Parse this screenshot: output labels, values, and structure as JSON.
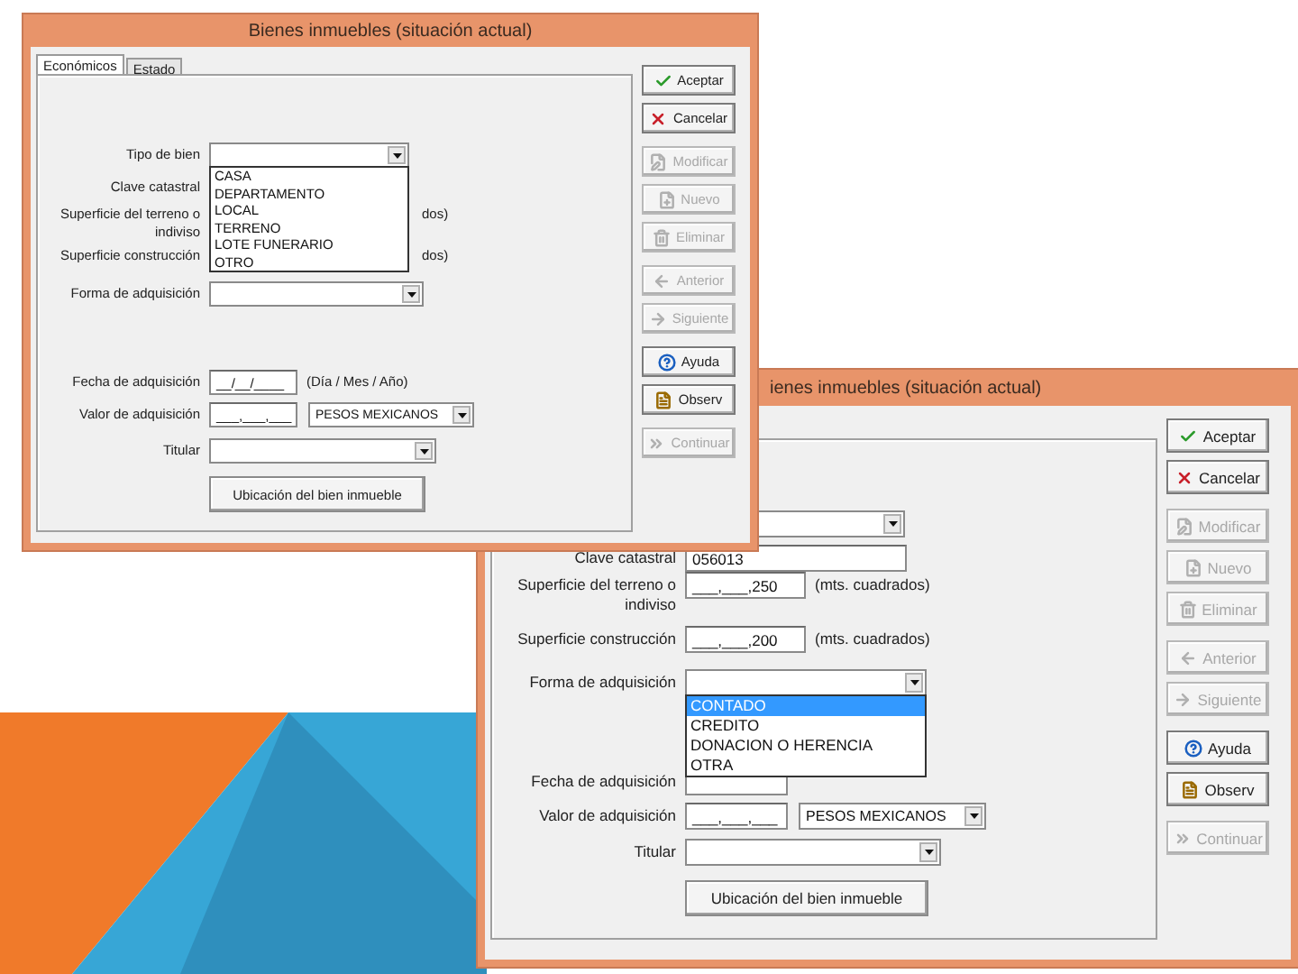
{
  "windows": [
    {
      "title": "Bienes inmuebles (situación actual)",
      "tabs": [
        {
          "label": "Económicos",
          "selected": true
        },
        {
          "label": "Estado",
          "selected": false
        }
      ],
      "rows": [
        {
          "kind": "field",
          "label": "Tipo de bien",
          "fields": [
            {
              "kind": "combo",
              "options": [
                {
                  "label": "CASA",
                  "selected": false
                },
                {
                  "label": "DEPARTAMENTO",
                  "selected": false
                },
                {
                  "label": "LOCAL",
                  "selected": false
                },
                {
                  "label": "TERRENO",
                  "selected": false
                },
                {
                  "label": "LOTE FUNERARIO",
                  "selected": false
                },
                {
                  "label": "OTRO",
                  "selected": false
                }
              ]
            }
          ]
        },
        {
          "kind": "field",
          "label": "Clave catastral",
          "fields": []
        },
        {
          "kind": "field",
          "label": "Superficie del terreno o indiviso",
          "fields": [],
          "note": "dos)"
        },
        {
          "kind": "field",
          "label": "Superficie construcción",
          "fields": [],
          "note": "dos)"
        },
        {
          "kind": "field",
          "label": "Forma de adquisición",
          "fields": [
            {
              "kind": "combo"
            }
          ]
        },
        {
          "kind": "field",
          "label": "Fecha de adquisición",
          "fields": [
            {
              "kind": "text",
              "value": "__/__/____"
            }
          ],
          "note": "(Día / Mes / Año)"
        },
        {
          "kind": "field",
          "label": "Valor de adquisición",
          "fields": [
            {
              "kind": "text",
              "value": "___,___,___"
            },
            {
              "kind": "combo",
              "value": "PESOS MEXICANOS"
            }
          ]
        },
        {
          "kind": "field",
          "label": "Titular",
          "fields": [
            {
              "kind": "combo"
            }
          ]
        },
        {
          "kind": "button",
          "label": "Ubicación del bien inmueble"
        }
      ],
      "button_groups": [
        [
          {
            "label": "Aceptar",
            "disabled": false
          },
          {
            "label": "Cancelar",
            "disabled": false
          }
        ],
        [
          {
            "label": "Modificar",
            "disabled": true
          },
          {
            "label": "Nuevo",
            "disabled": true
          },
          {
            "label": "Eliminar",
            "disabled": true
          }
        ],
        [
          {
            "label": "Anterior",
            "disabled": true
          },
          {
            "label": "Siguiente",
            "disabled": true
          }
        ],
        [
          {
            "label": "Ayuda",
            "disabled": false
          },
          {
            "label": "Observ",
            "disabled": false
          }
        ],
        [
          {
            "label": "Continuar",
            "disabled": true
          }
        ]
      ]
    },
    {
      "title": "ienes inmuebles (situación actual)",
      "rows": [
        {
          "kind": "field",
          "fields": [
            {
              "kind": "combo"
            }
          ]
        },
        {
          "kind": "field",
          "label": "Clave catastral",
          "fields": [
            {
              "kind": "text",
              "value": "056013"
            }
          ]
        },
        {
          "kind": "field",
          "label": "Superficie del terreno o indiviso",
          "fields": [
            {
              "kind": "text",
              "value": "___,___,250"
            }
          ],
          "note": "(mts. cuadrados)"
        },
        {
          "kind": "field",
          "label": "Superficie construcción",
          "fields": [
            {
              "kind": "text",
              "value": "___,___,200"
            }
          ],
          "note": "(mts. cuadrados)"
        },
        {
          "kind": "field",
          "label": "Forma de adquisición",
          "fields": [
            {
              "kind": "combo",
              "options": [
                {
                  "label": "CONTADO",
                  "selected": true
                },
                {
                  "label": "CREDITO",
                  "selected": false
                },
                {
                  "label": "DONACION O HERENCIA",
                  "selected": false
                },
                {
                  "label": "OTRA",
                  "selected": false
                }
              ]
            }
          ]
        },
        {
          "kind": "field",
          "label": "Fecha de adquisición",
          "fields": [
            {
              "kind": "text"
            }
          ]
        },
        {
          "kind": "field",
          "label": "Valor de adquisición",
          "fields": [
            {
              "kind": "text",
              "value": "___,___,___"
            },
            {
              "kind": "combo",
              "value": "PESOS MEXICANOS"
            }
          ]
        },
        {
          "kind": "field",
          "label": "Titular",
          "fields": [
            {
              "kind": "combo"
            }
          ]
        },
        {
          "kind": "button",
          "label": "Ubicación del bien inmueble"
        }
      ],
      "button_groups": [
        [
          {
            "label": "Aceptar",
            "disabled": false
          },
          {
            "label": "Cancelar",
            "disabled": false
          }
        ],
        [
          {
            "label": "Modificar",
            "disabled": true
          },
          {
            "label": "Nuevo",
            "disabled": true
          },
          {
            "label": "Eliminar",
            "disabled": true
          }
        ],
        [
          {
            "label": "Anterior",
            "disabled": true
          },
          {
            "label": "Siguiente",
            "disabled": true
          }
        ],
        [
          {
            "label": "Ayuda",
            "disabled": false
          },
          {
            "label": "Observ",
            "disabled": false
          }
        ],
        [
          {
            "label": "Continuar",
            "disabled": true
          }
        ]
      ]
    }
  ]
}
